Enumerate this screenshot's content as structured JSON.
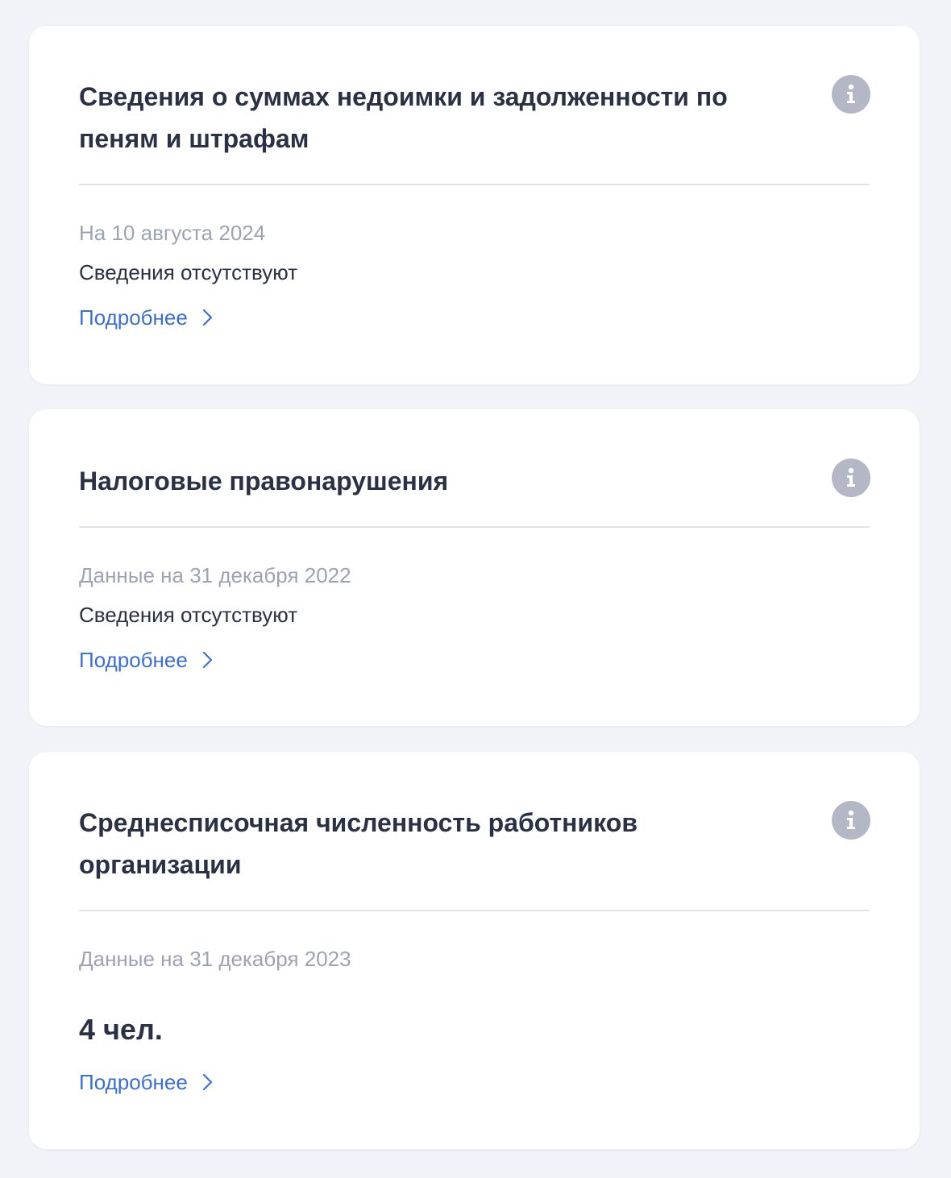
{
  "colors": {
    "page_background": "#f1f3f8",
    "card_background": "#ffffff",
    "title_text": "#2b3145",
    "muted_text": "#9da3b3",
    "link": "#3a6fd8",
    "info_icon_bg": "#b4b8c6",
    "divider": "#dfe2e9"
  },
  "cards": [
    {
      "title": "Сведения о суммах недоимки и задолженности по пеням и штрафам",
      "info_icon": "info-icon",
      "date_label": "На 10 августа 2024",
      "status": "Сведения отсутствуют",
      "link_label": "Подробнее",
      "link_icon": "chevron-right-icon"
    },
    {
      "title": "Налоговые правонарушения",
      "info_icon": "info-icon",
      "date_label": "Данные на 31 декабря 2022",
      "status": "Сведения отсутствуют",
      "link_label": "Подробнее",
      "link_icon": "chevron-right-icon"
    },
    {
      "title": "Среднесписочная численность работников организации",
      "info_icon": "info-icon",
      "date_label": "Данные на 31 декабря 2023",
      "value": "4 чел.",
      "link_label": "Подробнее",
      "link_icon": "chevron-right-icon"
    }
  ]
}
